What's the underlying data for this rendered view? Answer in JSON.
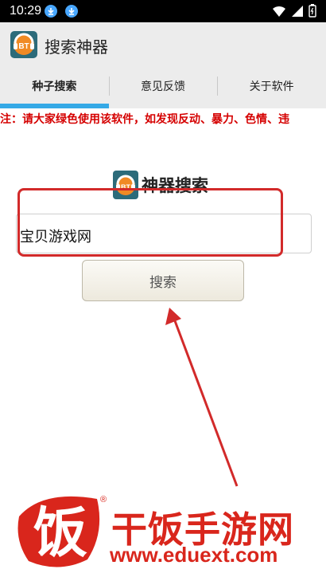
{
  "status_bar": {
    "time": "10:29"
  },
  "app_bar": {
    "title": "搜索神器"
  },
  "tabs": [
    {
      "label": "种子搜索",
      "active": true
    },
    {
      "label": "意见反馈",
      "active": false
    },
    {
      "label": "关于软件",
      "active": false
    }
  ],
  "notice": "注：请大家绿色使用该软件，如发现反动、暴力、色情、违",
  "main": {
    "heading": "神器搜索",
    "search_value": "宝贝游戏网",
    "search_button": "搜索"
  },
  "watermark": {
    "logo_char": "饭",
    "brand": "干饭手游网",
    "url": "www.eduext.com"
  },
  "colors": {
    "accent": "#35a9e6",
    "notice": "#d50000",
    "highlight": "#d22a2a",
    "brand": "#d9261c"
  }
}
